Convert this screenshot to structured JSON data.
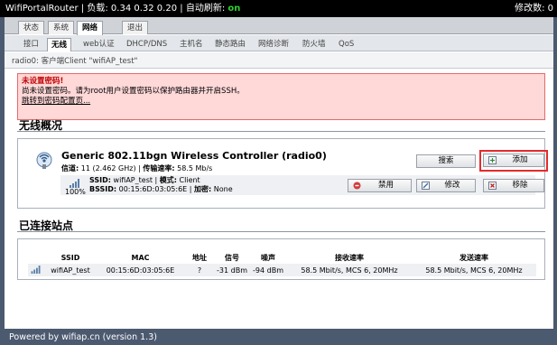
{
  "topbar": {
    "hostname": "WifiPortalRouter",
    "load_text": "负载: 0.34 0.32 0.20",
    "autorefresh_label": "自动刷新:",
    "autorefresh_state": "on",
    "changes": "修改数: 0"
  },
  "nav": {
    "main_tabs": [
      {
        "label": "状态"
      },
      {
        "label": "系统"
      },
      {
        "label": "网络"
      },
      {
        "label": "退出"
      }
    ],
    "sub_tabs": [
      {
        "label": "接口"
      },
      {
        "label": "无线"
      },
      {
        "label": "web认证"
      },
      {
        "label": "DHCP/DNS"
      },
      {
        "label": "主机名"
      },
      {
        "label": "静态路由"
      },
      {
        "label": "网络诊断"
      },
      {
        "label": "防火墙"
      },
      {
        "label": "QoS"
      }
    ],
    "breadcrumb": "radio0: 客户端Client \"wifiAP_test\""
  },
  "alert": {
    "title": "未设置密码!",
    "message": "尚未设置密码。请为root用户设置密码以保护路由器并开启SSH。",
    "link": "跳转到密码配置页..."
  },
  "wireless": {
    "section_title": "无线概况",
    "device_name": "Generic 802.11bgn Wireless Controller (radio0)",
    "channel_label": "信道:",
    "channel_value": "11 (2.462 GHz)",
    "rate_label": "传输速率:",
    "rate_value": "58.5 Mb/s",
    "buttons": {
      "scan": "搜索",
      "add": "添加",
      "disable": "禁用",
      "edit": "修改",
      "remove": "移除"
    },
    "network": {
      "signal_percent": "100%",
      "ssid_label": "SSID:",
      "ssid_value": "wifiAP_test",
      "mode_label": "模式:",
      "mode_value": "Client",
      "bssid_label": "BSSID:",
      "bssid_value": "00:15:6D:03:05:6E",
      "encryption_label": "加密:",
      "encryption_value": "None"
    }
  },
  "stations": {
    "section_title": "已连接站点",
    "columns": [
      "SSID",
      "MAC",
      "地址",
      "信号",
      "噪声",
      "接收速率",
      "发送速率"
    ],
    "rows": [
      [
        "wifiAP_test",
        "00:15:6D:03:05:6E",
        "?",
        "-31 dBm",
        "-94 dBm",
        "58.5 Mbit/s, MCS 6, 20MHz",
        "58.5 Mbit/s, MCS 6, 20MHz"
      ]
    ]
  },
  "footer": "Powered by wifiap.cn (version 1.3)",
  "colors": {
    "background": "#4c5a70",
    "alert_bg": "#ffd8d8",
    "alert_border": "#e36b6b",
    "highlight": "#e52b2b",
    "on_green": "#2bd12b"
  },
  "icons": {
    "device": "wireless-device-icon",
    "signal": "signal-bars-icon",
    "add": "add-icon",
    "disable": "disable-icon",
    "edit": "edit-icon",
    "remove": "remove-icon"
  }
}
